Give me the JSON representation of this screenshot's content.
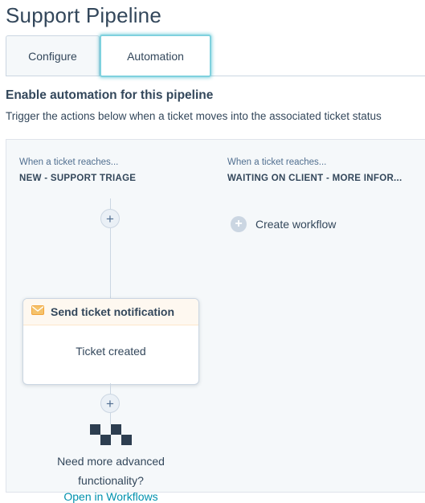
{
  "page": {
    "title": "Support Pipeline"
  },
  "tabs": [
    {
      "label": "Configure"
    },
    {
      "label": "Automation"
    }
  ],
  "section": {
    "title": "Enable automation for this pipeline",
    "description": "Trigger the actions below when a ticket moves into the associated ticket status"
  },
  "columns": [
    {
      "when_label": "When a ticket reaches...",
      "stage": "NEW - SUPPORT TRIAGE",
      "action_card": {
        "icon": "envelope-icon",
        "title": "Send ticket notification",
        "subtitle": "Ticket created"
      },
      "more_text_line1": "Need more advanced",
      "more_text_line2": "functionality?",
      "link_text": "Open in Workflows"
    },
    {
      "when_label": "When a ticket reaches...",
      "stage": "WAITING ON CLIENT - MORE INFOR...",
      "create_label": "Create workflow"
    }
  ],
  "icons": {
    "plus": "+",
    "accent_link_color": "#0091ae",
    "focus_color": "#7fd1de"
  }
}
